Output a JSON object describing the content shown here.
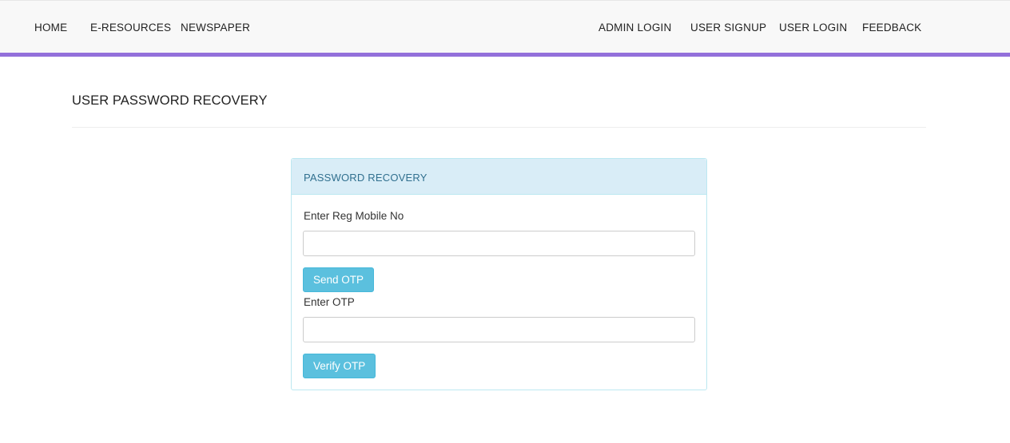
{
  "nav": {
    "left": [
      {
        "label": "HOME"
      },
      {
        "label": "E-RESOURCES"
      },
      {
        "label": "NEWSPAPER"
      }
    ],
    "right": [
      {
        "label": "ADMIN LOGIN"
      },
      {
        "label": "USER SIGNUP"
      },
      {
        "label": "USER LOGIN"
      },
      {
        "label": "FEEDBACK"
      }
    ]
  },
  "page": {
    "title": "USER PASSWORD RECOVERY"
  },
  "panel": {
    "title": "PASSWORD RECOVERY",
    "mobile_label": "Enter Reg Mobile No",
    "mobile_value": "",
    "send_otp_label": "Send OTP",
    "otp_label": "Enter OTP",
    "otp_value": "",
    "verify_otp_label": "Verify OTP"
  },
  "colors": {
    "nav_accent": "#9370db",
    "panel_heading_bg": "#d9edf7",
    "panel_border": "#bce8f1",
    "button_info": "#5bc0de"
  }
}
